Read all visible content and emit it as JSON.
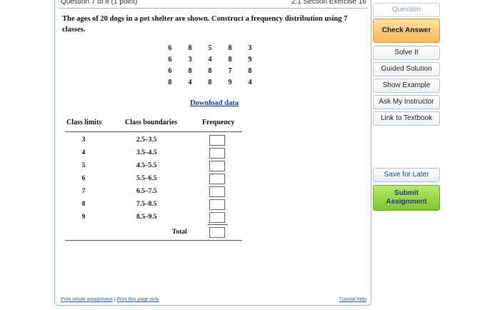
{
  "header": {
    "question_label": "Question 7 of 8 (1 point)",
    "section_label": "2.1 Section Exercise 16"
  },
  "problem": {
    "text": "The ages of 20 dogs in a pet shelter are shown. Construct a frequency distribution using 7 classes."
  },
  "dataset": [
    [
      "6",
      "8",
      "5",
      "8",
      "3"
    ],
    [
      "6",
      "3",
      "4",
      "8",
      "9"
    ],
    [
      "6",
      "8",
      "8",
      "7",
      "8"
    ],
    [
      "8",
      "4",
      "8",
      "9",
      "4"
    ]
  ],
  "download_label": "Download data",
  "table": {
    "headers": {
      "limits": "Class limits",
      "boundaries": "Class boundaries",
      "frequency": "Frequency"
    },
    "rows": [
      {
        "limit": "3",
        "boundary": "2.5–3.5",
        "frequency": ""
      },
      {
        "limit": "4",
        "boundary": "3.5–4.5",
        "frequency": ""
      },
      {
        "limit": "5",
        "boundary": "4.5–5.5",
        "frequency": ""
      },
      {
        "limit": "6",
        "boundary": "5.5–6.5",
        "frequency": ""
      },
      {
        "limit": "7",
        "boundary": "6.5–7.5",
        "frequency": ""
      },
      {
        "limit": "8",
        "boundary": "7.5–8.5",
        "frequency": ""
      },
      {
        "limit": "9",
        "boundary": "8.5–9.5",
        "frequency": ""
      }
    ],
    "total_label": "Total",
    "total_value": ""
  },
  "footer": {
    "print_assignment": "Print whole assignment",
    "separator": "|",
    "print_page": "Print this page only",
    "tutorial_help": "Tutorial help"
  },
  "sidebar": {
    "question": "Question",
    "check_answer": "Check Answer",
    "solve_it": "Solve It",
    "guided_solution": "Guided Solution",
    "show_example": "Show Example",
    "ask_instructor": "Ask My Instructor",
    "link_textbook": "Link to Textbook",
    "save_later": "Save for Later",
    "submit_line1": "Submit",
    "submit_line2": "Assignment"
  },
  "colors": {
    "check_answer_bg": "#f7b955",
    "submit_bg": "#7fc52d",
    "link": "#1a3e9a"
  }
}
